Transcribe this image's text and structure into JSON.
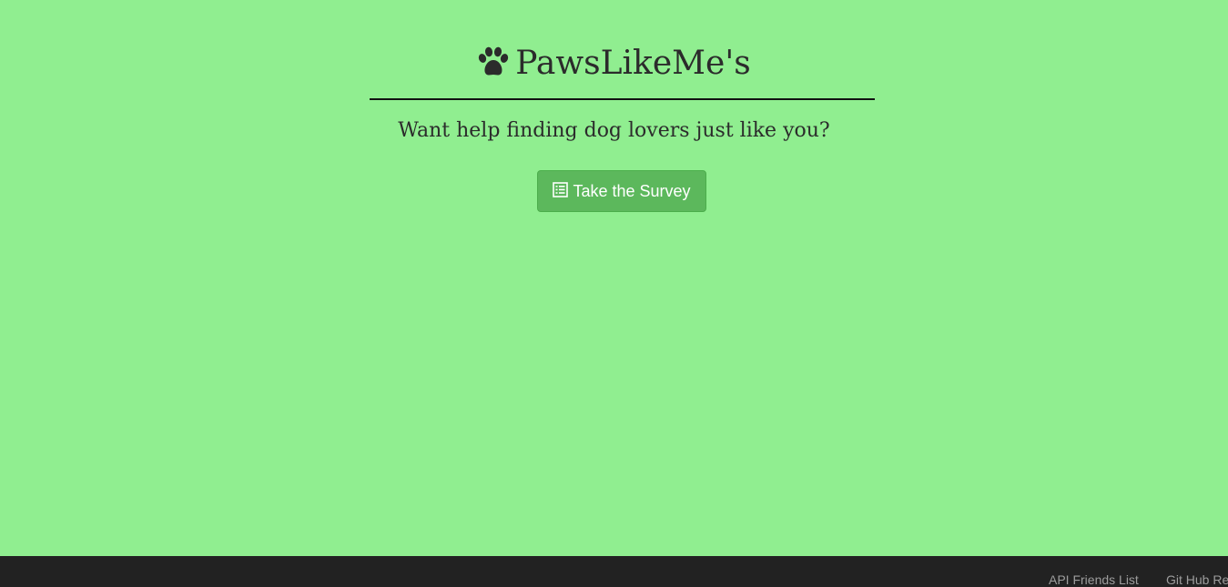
{
  "header": {
    "title": "PawsLikeMe's",
    "title_icon": "paw-icon",
    "subtitle": "Want help finding dog lovers just like you?"
  },
  "actions": {
    "survey_label": "Take the Survey",
    "survey_icon": "list-icon"
  },
  "footer": {
    "links": [
      {
        "label": "API Friends List"
      },
      {
        "label": "Git Hub Re"
      }
    ]
  },
  "colors": {
    "background": "#90ee90",
    "button": "#5cb85c",
    "footer": "#222222",
    "footer_link": "#9d9d9d"
  }
}
